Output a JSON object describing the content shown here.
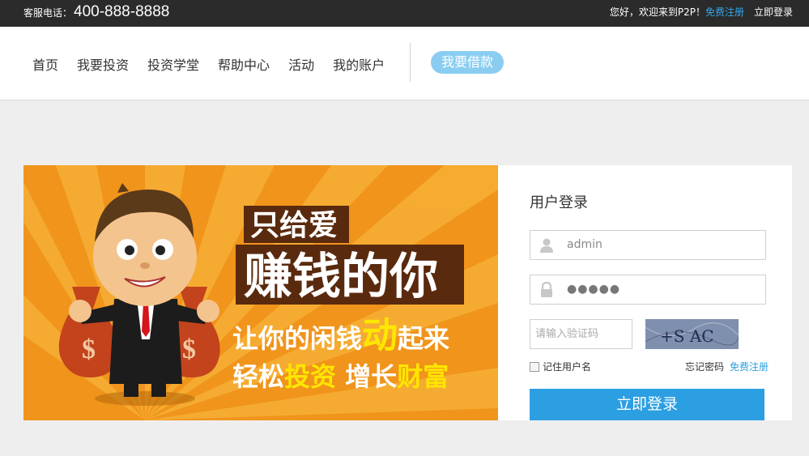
{
  "topbar": {
    "hotline_label": "客服电话：",
    "hotline_number": "400-888-8888",
    "welcome": "您好，欢迎来到P2P！",
    "register_link": "免费注册",
    "login_link": "立即登录"
  },
  "nav": {
    "items": [
      "首页",
      "我要投资",
      "投资学堂",
      "帮助中心",
      "活动",
      "我的账户"
    ],
    "borrow_label": "我要借款"
  },
  "banner": {
    "line1": "只给爱",
    "line2": "赚钱的你",
    "line3a": "让你的闲钱",
    "line3b": "动",
    "line3c": "起来",
    "line4a": "轻松",
    "line4b": "投资",
    "line4c": " 增长",
    "line4d": "财富",
    "bag_symbol": "$",
    "colors": {
      "background": "#f0941c",
      "rays": "#f7b035",
      "highlight": "#ffe600",
      "title_text": "#ffffff",
      "title_shadow": "#5a2a0e"
    }
  },
  "login": {
    "title": "用户登录",
    "username_value": "admin",
    "password_value": "●●●●●",
    "captcha_placeholder": "请输入验证码",
    "captcha_text": "+S  AC",
    "remember_label": "记住用户名",
    "forgot_label": "忘记密码",
    "register_label": "免费注册",
    "submit_label": "立即登录",
    "accent_color": "#2c9fe3"
  }
}
